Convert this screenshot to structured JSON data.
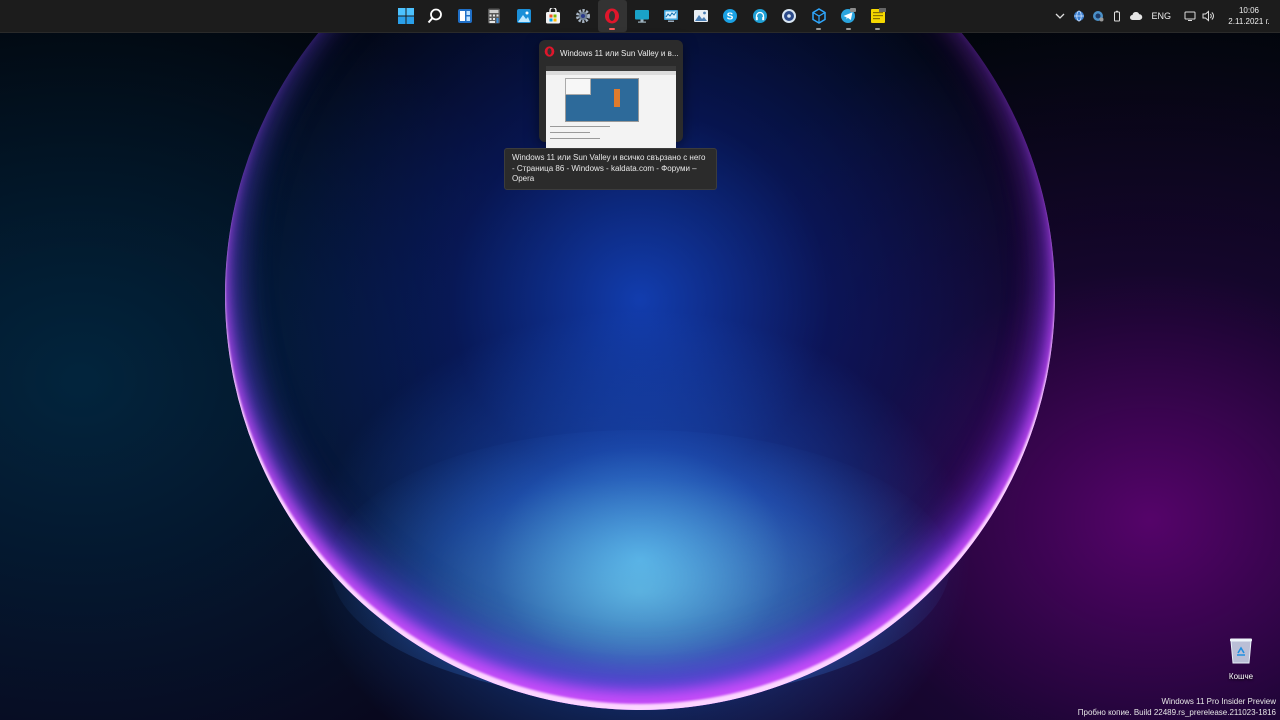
{
  "taskbar": {
    "apps": [
      {
        "icon": "windows-start-icon",
        "name": "start",
        "running": false
      },
      {
        "icon": "search-icon",
        "name": "search",
        "running": false
      },
      {
        "icon": "widgets-icon",
        "name": "widgets",
        "running": false
      },
      {
        "icon": "calculator-icon",
        "name": "calculator",
        "running": false
      },
      {
        "icon": "photos-icon",
        "name": "photos",
        "running": false
      },
      {
        "icon": "store-icon",
        "name": "store",
        "running": false
      },
      {
        "icon": "settings-gear-icon",
        "name": "settings",
        "running": false
      },
      {
        "icon": "opera-icon",
        "name": "opera",
        "running": true,
        "active": true
      },
      {
        "icon": "monitor-icon",
        "name": "remote-desktop",
        "running": false
      },
      {
        "icon": "monitor-cpu-icon",
        "name": "system-monitor",
        "running": false
      },
      {
        "icon": "image-editor-icon",
        "name": "image-editor",
        "running": false
      },
      {
        "icon": "skype-icon",
        "name": "skype",
        "running": false
      },
      {
        "icon": "headphones-icon",
        "name": "audio-app",
        "running": false
      },
      {
        "icon": "media-player-icon",
        "name": "media-player",
        "running": false
      },
      {
        "icon": "cube-icon",
        "name": "3d-app",
        "running": true
      },
      {
        "icon": "telegram-icon",
        "name": "telegram",
        "running": true
      },
      {
        "icon": "sticky-notes-icon",
        "name": "notes",
        "running": true
      }
    ],
    "tray": {
      "language": "ENG",
      "time": "10:06",
      "date": "2.11.2021 г."
    }
  },
  "preview": {
    "title": "Windows 11 или Sun Valley и в..."
  },
  "tooltip": {
    "text": "Windows 11 или Sun Valley и всичко свързано с него - Страница 86 - Windows - kaldata.com - Форуми – Opera"
  },
  "desktop": {
    "recycle_bin_label": "Кошче"
  },
  "watermark": {
    "line1": "Windows 11 Pro Insider Preview",
    "line2": "Пробно копие. Build 22489.rs_prerelease.211023-1816"
  }
}
